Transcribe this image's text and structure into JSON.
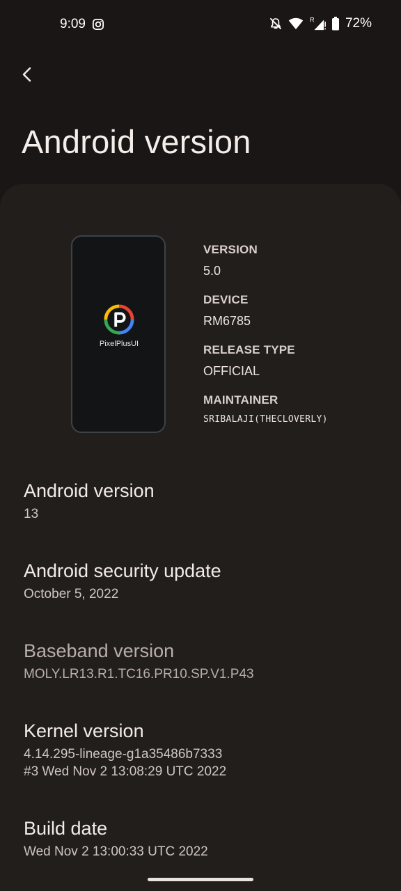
{
  "status_bar": {
    "time": "9:09",
    "battery_percent": "72%",
    "network_label": "R"
  },
  "header": {
    "title": "Android version"
  },
  "rom": {
    "name": "PixelPlusUI",
    "version_label": "VERSION",
    "version_value": "5.0",
    "device_label": "DEVICE",
    "device_value": "RM6785",
    "release_type_label": "RELEASE TYPE",
    "release_type_value": "OFFICIAL",
    "maintainer_label": "MAINTAINER",
    "maintainer_value": "SRIBALAJI(THECLOVERLY)"
  },
  "preferences": [
    {
      "title": "Android version",
      "summary": "13"
    },
    {
      "title": "Android security update",
      "summary": "October 5, 2022"
    },
    {
      "title": "Baseband version",
      "summary": "MOLY.LR13.R1.TC16.PR10.SP.V1.P43"
    },
    {
      "title": "Kernel version",
      "summary": "4.14.295-lineage-g1a35486b7333\n#3 Wed Nov 2 13:08:29 UTC 2022"
    },
    {
      "title": "Build date",
      "summary": "Wed Nov  2 13:00:33 UTC 2022"
    }
  ],
  "icons": {
    "back": "back-arrow-icon",
    "instagram": "instagram-icon",
    "mute": "notifications-off-icon",
    "wifi": "wifi-icon",
    "signal": "cellular-signal-icon",
    "battery": "battery-icon",
    "rom_logo": "pixelplus-logo-icon"
  }
}
